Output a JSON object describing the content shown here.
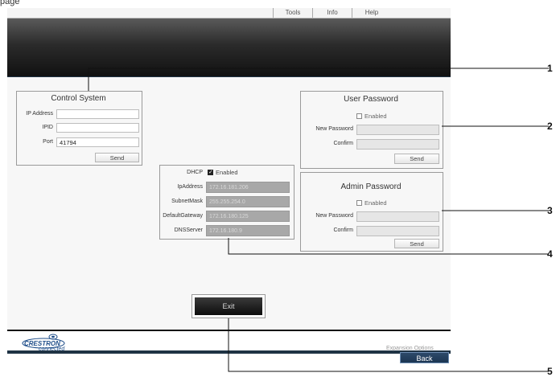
{
  "page_title": "page",
  "menu": [
    "Tools",
    "Info",
    "Help"
  ],
  "control_system": {
    "title": "Control System",
    "ip_label": "IP Address",
    "ip_value": "",
    "ipid_label": "IPID",
    "ipid_value": "",
    "port_label": "Port",
    "port_value": "41794",
    "send": "Send"
  },
  "user_password": {
    "title": "User Password",
    "enabled": "Enabled",
    "new_label": "New Password",
    "confirm_label": "Confirm",
    "send": "Send"
  },
  "admin_password": {
    "title": "Admin Password",
    "enabled": "Enabled",
    "new_label": "New Password",
    "confirm_label": "Confirm",
    "send": "Send"
  },
  "network": {
    "dhcp_label": "DHCP",
    "dhcp_enabled": "Enabled",
    "ip_label": "IpAddress",
    "ip_value": "172.16.181.206",
    "subnet_label": "SubnetMask",
    "subnet_value": "255.255.254.0",
    "gateway_label": "DefaultGateway",
    "gateway_value": "172.16.180.125",
    "dns_label": "DNSServer",
    "dns_value": "172.16.180.9"
  },
  "exit": "Exit",
  "footer": {
    "logo_top": "CRESTRON",
    "logo_bottom": "connected",
    "expansion": "Expansion Options"
  },
  "back": "Back",
  "callouts": [
    "1",
    "2",
    "3",
    "4",
    "5"
  ]
}
